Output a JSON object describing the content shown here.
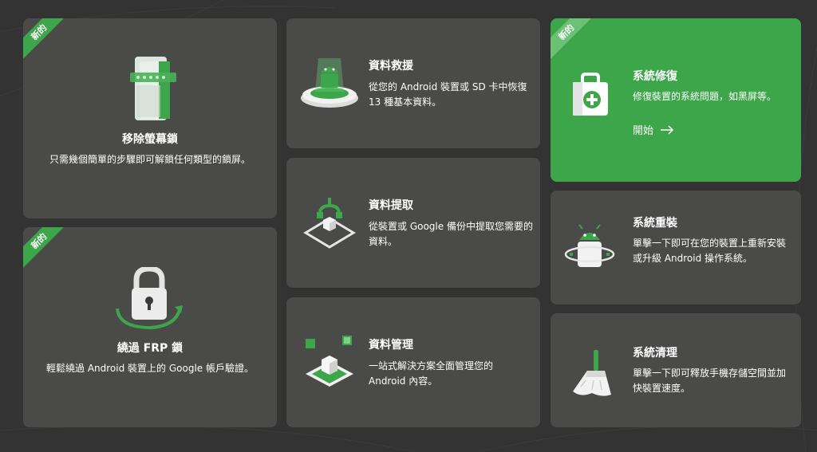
{
  "badge_new": "新的",
  "cards": {
    "remove_lock": {
      "title": "移除螢幕鎖",
      "desc": "只需幾個簡單的步驟即可解鎖任何類型的鎖屏。"
    },
    "bypass_frp": {
      "title": "繞過 FRP 鎖",
      "desc": "輕鬆繞過 Android 裝置上的 Google 帳戶驗證。"
    },
    "data_recovery": {
      "title": "資料救援",
      "desc": "從您的 Android 裝置或 SD 卡中恢復 13 種基本資料。"
    },
    "data_extract": {
      "title": "資料提取",
      "desc": "從裝置或 Google 備份中提取您需要的資料。"
    },
    "data_manage": {
      "title": "資料管理",
      "desc": "一站式解決方案全面管理您的 Android 內容。"
    },
    "system_repair": {
      "title": "系統修復",
      "desc": "修復裝置的系統問題，如黑屏等。",
      "start_label": "開始"
    },
    "system_reinstall": {
      "title": "系統重裝",
      "desc": "單擊一下即可在您的裝置上重新安裝或升級 Android 操作系統。"
    },
    "system_clean": {
      "title": "系統清理",
      "desc": "單擊一下即可釋放手機存儲空間並加快裝置速度。"
    }
  },
  "colors": {
    "background": "#323332",
    "card": "#4a4a49",
    "accent": "#3ea64a"
  }
}
